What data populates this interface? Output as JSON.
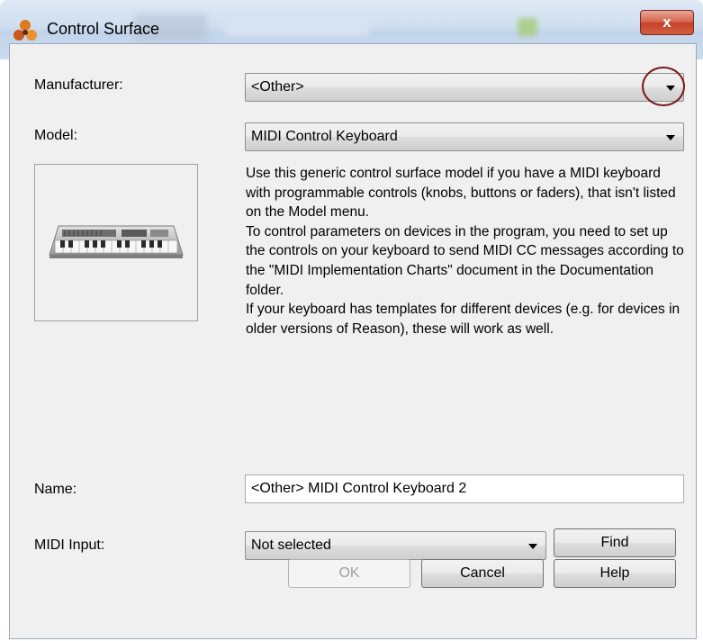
{
  "window": {
    "title": "Control Surface",
    "close_label": "x"
  },
  "form": {
    "manufacturer_label": "Manufacturer:",
    "manufacturer_value": "<Other>",
    "model_label": "Model:",
    "model_value": "MIDI Control Keyboard",
    "description": [
      "Use this generic control surface model if you have a MIDI keyboard with programmable controls (knobs, buttons or faders), that isn't listed on the Model menu.",
      "To control parameters on devices in the program, you need to set up the controls on your keyboard to send MIDI CC messages according to the \"MIDI Implementation Charts\" document in the Documentation folder.",
      "If your keyboard has templates for different devices (e.g. for devices in older versions of Reason), these will work as well."
    ],
    "name_label": "Name:",
    "name_value": "<Other> MIDI Control Keyboard 2",
    "midi_input_label": "MIDI Input:",
    "midi_input_value": "Not selected",
    "find_label": "Find"
  },
  "buttons": {
    "ok": "OK",
    "cancel": "Cancel",
    "help": "Help"
  }
}
